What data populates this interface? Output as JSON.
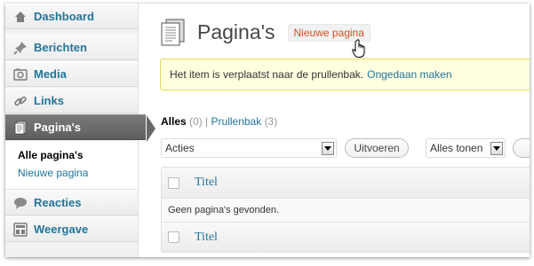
{
  "sidebar": {
    "items": [
      {
        "label": "Dashboard",
        "icon": "dashboard-icon"
      },
      {
        "label": "Berichten",
        "icon": "pin-icon"
      },
      {
        "label": "Media",
        "icon": "media-icon"
      },
      {
        "label": "Links",
        "icon": "link-icon"
      },
      {
        "label": "Pagina's",
        "icon": "pages-icon",
        "active": true
      },
      {
        "label": "Reacties",
        "icon": "comment-icon"
      },
      {
        "label": "Weergave",
        "icon": "appearance-icon"
      }
    ],
    "submenu": [
      {
        "label": "Alle pagina's",
        "current": true
      },
      {
        "label": "Nieuwe pagina"
      }
    ]
  },
  "header": {
    "title": "Pagina's",
    "add_new_label": "Nieuwe pagina"
  },
  "notice": {
    "message": "Het item is verplaatst naar de prullenbak.",
    "undo_label": "Ongedaan maken"
  },
  "filters": {
    "all_label": "Alles",
    "all_count": "(0)",
    "separator": "|",
    "trash_label": "Prullenbak",
    "trash_count": "(3)"
  },
  "tablenav": {
    "bulk_action_value": "Acties",
    "apply_label": "Uitvoeren",
    "date_filter_value": "Alles tonen"
  },
  "table": {
    "column_title": "Titel",
    "empty_message": "Geen pagina's gevonden."
  },
  "colors": {
    "link": "#21759b",
    "add_new": "#d54e21",
    "notice_bg": "#ffffe0",
    "active_menu": "#6d6d6d"
  }
}
